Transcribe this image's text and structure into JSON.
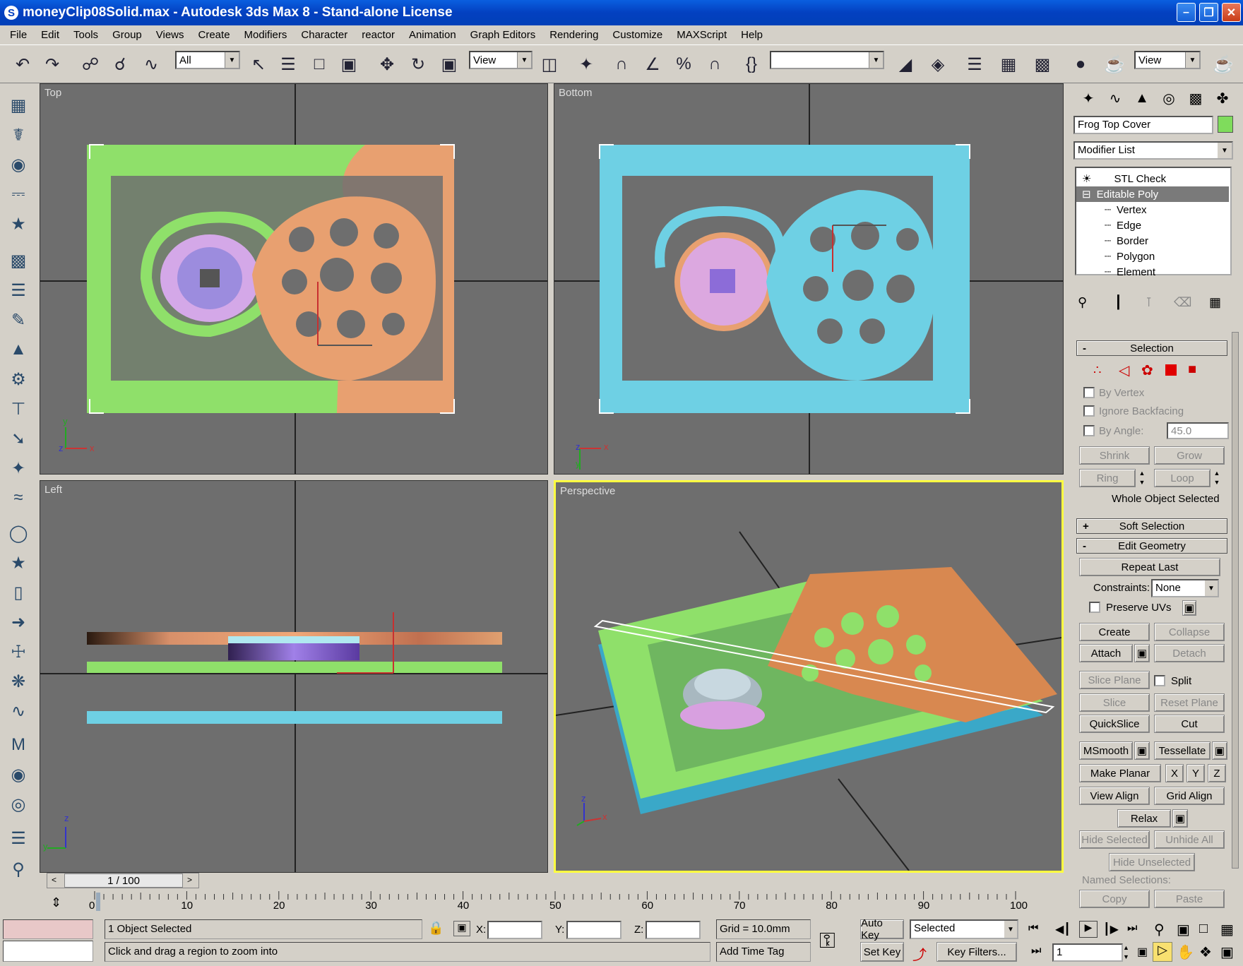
{
  "window": {
    "title": "moneyClip08Solid.max - Autodesk 3ds Max 8  - Stand-alone License"
  },
  "menu": [
    "File",
    "Edit",
    "Tools",
    "Group",
    "Views",
    "Create",
    "Modifiers",
    "Character",
    "reactor",
    "Animation",
    "Graph Editors",
    "Rendering",
    "Customize",
    "MAXScript",
    "Help"
  ],
  "toolbar": {
    "filter_value": "All",
    "coord_value": "View",
    "named_sel_value": "",
    "render_view_value": "View"
  },
  "viewports": {
    "top": "Top",
    "bottom": "Bottom",
    "left": "Left",
    "perspective": "Perspective"
  },
  "axes": {
    "x": "x",
    "y": "y",
    "z": "z"
  },
  "command_panel": {
    "object_name": "Frog Top Cover",
    "object_color": "#7fdc5c",
    "modifier_list": "Modifier List",
    "stack": [
      {
        "label": "STL Check"
      },
      {
        "label": "Editable Poly",
        "selected": true
      },
      {
        "label": "Vertex"
      },
      {
        "label": "Edge"
      },
      {
        "label": "Border"
      },
      {
        "label": "Polygon"
      },
      {
        "label": "Element"
      }
    ],
    "selection": {
      "title": "Selection",
      "by_vertex": "By Vertex",
      "ignore_backfacing": "Ignore Backfacing",
      "by_angle": "By Angle:",
      "angle_value": "45.0",
      "shrink": "Shrink",
      "grow": "Grow",
      "ring": "Ring",
      "loop": "Loop",
      "status": "Whole Object Selected"
    },
    "soft_selection": "Soft Selection",
    "edit_geometry": {
      "title": "Edit Geometry",
      "repeat_last": "Repeat Last",
      "constraints": "Constraints:",
      "constraints_value": "None",
      "preserve_uvs": "Preserve UVs",
      "create": "Create",
      "collapse": "Collapse",
      "attach": "Attach",
      "detach": "Detach",
      "slice_plane": "Slice Plane",
      "split": "Split",
      "slice": "Slice",
      "reset_plane": "Reset Plane",
      "quickslice": "QuickSlice",
      "cut": "Cut",
      "msmooth": "MSmooth",
      "tessellate": "Tessellate",
      "make_planar": "Make Planar",
      "x": "X",
      "y": "Y",
      "z": "Z",
      "view_align": "View Align",
      "grid_align": "Grid Align",
      "relax": "Relax",
      "hide_selected": "Hide Selected",
      "unhide_all": "Unhide All",
      "hide_unselected": "Hide Unselected",
      "named_selections": "Named Selections:",
      "copy": "Copy",
      "paste": "Paste"
    }
  },
  "timeline": {
    "frame_label": "1 / 100",
    "ticks": [
      "0",
      "10",
      "20",
      "30",
      "40",
      "50",
      "60",
      "70",
      "80",
      "90",
      "100"
    ]
  },
  "status": {
    "selected": "1 Object Selected",
    "prompt": "Click and drag a region to zoom into",
    "x_label": "X:",
    "y_label": "Y:",
    "z_label": "Z:",
    "grid": "Grid = 10.0mm",
    "add_time_tag": "Add Time Tag",
    "auto_key": "Auto Key",
    "set_key": "Set Key",
    "key_mode": "Selected",
    "key_filters": "Key Filters...",
    "frame": "1"
  }
}
